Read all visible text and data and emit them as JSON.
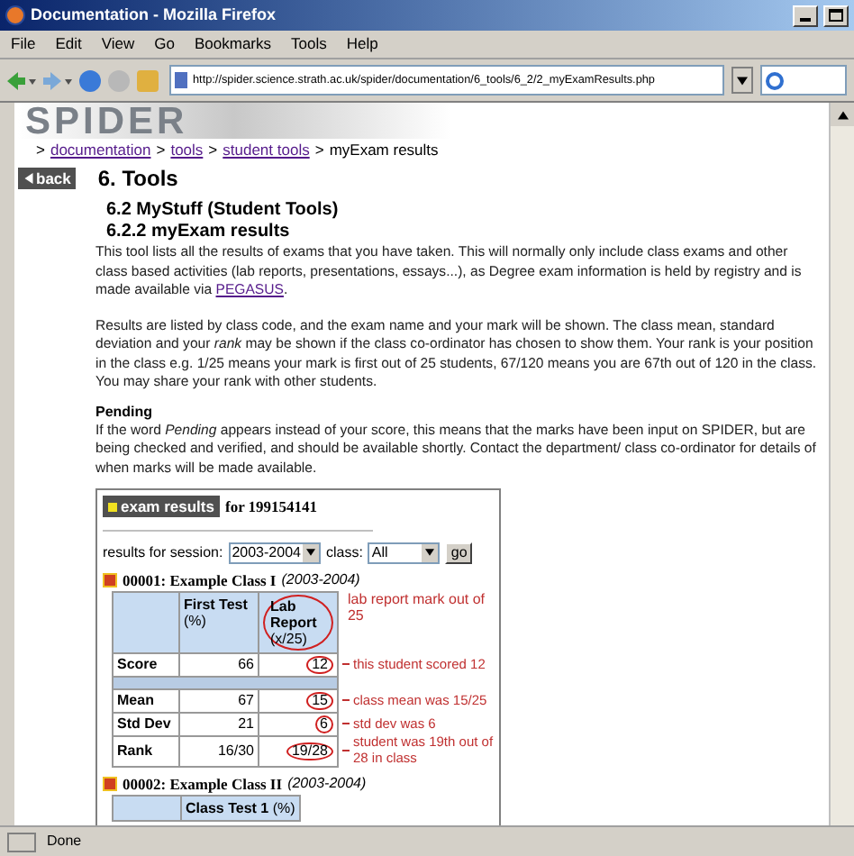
{
  "window": {
    "title": "Documentation - Mozilla Firefox"
  },
  "menu": [
    "File",
    "Edit",
    "View",
    "Go",
    "Bookmarks",
    "Tools",
    "Help"
  ],
  "toolbar": {
    "url": "http://spider.science.strath.ac.uk/spider/documentation/6_tools/6_2/2_myExamResults.php"
  },
  "banner": {
    "logo": "SPIDER"
  },
  "breadcrumb": {
    "separator": ">",
    "items": [
      {
        "text": "documentation",
        "link": true
      },
      {
        "text": "tools",
        "link": true
      },
      {
        "text": "student tools",
        "link": true
      },
      {
        "text": "myExam results",
        "link": false
      }
    ]
  },
  "back_button": "back",
  "heading": "6. Tools",
  "subheading": "6.2 MyStuff (Student Tools)",
  "subsubheading": "6.2.2 myExam results",
  "intro": {
    "before": "This tool lists all the results of exams that you have taken. This will normally only include class exams and other class based activities (lab reports, presentations, essays...), as Degree exam information is held by registry and is made available via",
    "link": "PEGASUS",
    "after": "."
  },
  "paragraph": "Results are listed by class code, and the exam name and your mark will be shown. The class mean, standard deviation and your *rank* may be shown if the class co-ordinator has chosen to show them. Your rank is your position in the class e.g. 1/25 means your mark is first out of 25 students, 67/120 means you are 67th out of 120 in the class.  You may share your rank with other students.",
  "pending": {
    "title": "Pending",
    "text": "If the word *Pending* appears instead of your score, this means that the marks have been input on SPIDER, but are being checked and verified, and should be available shortly. Contact the department/ class co-ordinator for details of when marks will be made available."
  },
  "results": {
    "badge": "exam results",
    "student": "for 199154141",
    "session_label": "results for session:",
    "session": "2003-2004",
    "class_label": "class:",
    "class": "All",
    "go": "go",
    "classes": [
      {
        "code": "00001: Example Class I",
        "session": "(2003-2004)",
        "columns": [
          {
            "name": "First Test",
            "unit": "(%)",
            "circled": false
          },
          {
            "name": "Lab Report",
            "unit": "(x/25)",
            "circled": true,
            "note": "lab report mark out of 25"
          }
        ],
        "rows": [
          {
            "label": "Score",
            "values": [
              "66",
              "12"
            ],
            "circled": [
              false,
              true
            ],
            "note": "this student scored 12"
          },
          {
            "label": "Mean",
            "values": [
              "67",
              "15"
            ],
            "circled": [
              false,
              true
            ],
            "note": "class mean was 15/25"
          },
          {
            "label": "Std Dev",
            "values": [
              "21",
              "6"
            ],
            "circled": [
              false,
              true
            ],
            "note": "std dev was 6"
          },
          {
            "label": "Rank",
            "values": [
              "16/30",
              "19/28"
            ],
            "circled": [
              false,
              true
            ],
            "note": "student was 19th out of 28 in class"
          }
        ]
      },
      {
        "code": "00002: Example Class II",
        "session": "(2003-2004)",
        "columns": [
          {
            "name": "Class Test 1",
            "unit": "(%)",
            "circled": false
          }
        ]
      }
    ]
  },
  "status_bar": "Done"
}
